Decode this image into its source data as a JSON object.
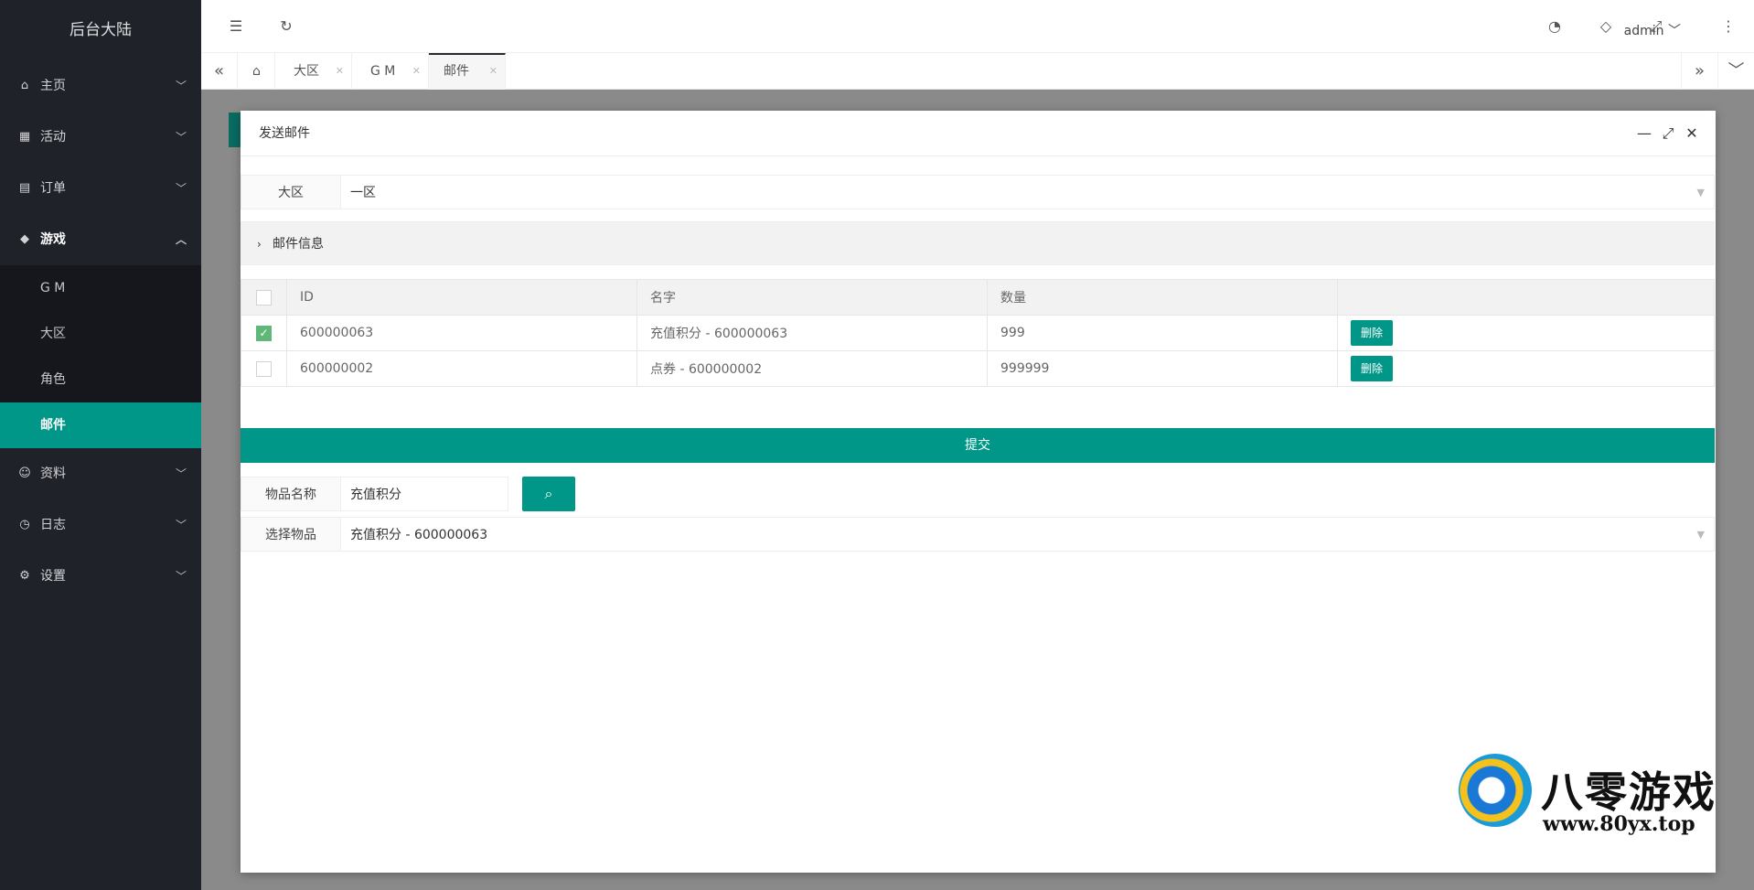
{
  "sidebar": {
    "logo": "后台大陆",
    "items": [
      {
        "label": "主页",
        "icon": "home-icon"
      },
      {
        "label": "活动",
        "icon": "gift-icon"
      },
      {
        "label": "订单",
        "icon": "order-icon"
      },
      {
        "label": "游戏",
        "icon": "diamond-icon"
      },
      {
        "label": "资料",
        "icon": "user-icon"
      },
      {
        "label": "日志",
        "icon": "clock-icon"
      },
      {
        "label": "设置",
        "icon": "gear-icon"
      }
    ],
    "sub_items": [
      "G M",
      "大区",
      "角色",
      "邮件"
    ]
  },
  "header": {
    "user": "admin"
  },
  "tabs": [
    {
      "label": "大区"
    },
    {
      "label": "G M"
    },
    {
      "label": "邮件"
    }
  ],
  "modal": {
    "title": "发送邮件",
    "region_label": "大区",
    "region_value": "一区",
    "collapse_title": "邮件信息",
    "table": {
      "headers": [
        "ID",
        "名字",
        "数量",
        ""
      ],
      "rows": [
        {
          "id": "600000063",
          "name": "充值积分 - 600000063",
          "qty": "999",
          "checked": true,
          "action": "删除"
        },
        {
          "id": "600000002",
          "name": "点券 - 600000002",
          "qty": "999999",
          "checked": false,
          "action": "删除"
        }
      ]
    },
    "submit_label": "提交",
    "item_name_label": "物品名称",
    "item_name_value": "充值积分",
    "select_item_label": "选择物品",
    "select_item_value": "充值积分 - 600000063"
  },
  "watermark": {
    "text": "八零游戏",
    "url": "www.80yx.top"
  },
  "colors": {
    "sidebar_bg": "#20222a",
    "accent": "#009688",
    "checkbox_on": "#5fb878"
  }
}
